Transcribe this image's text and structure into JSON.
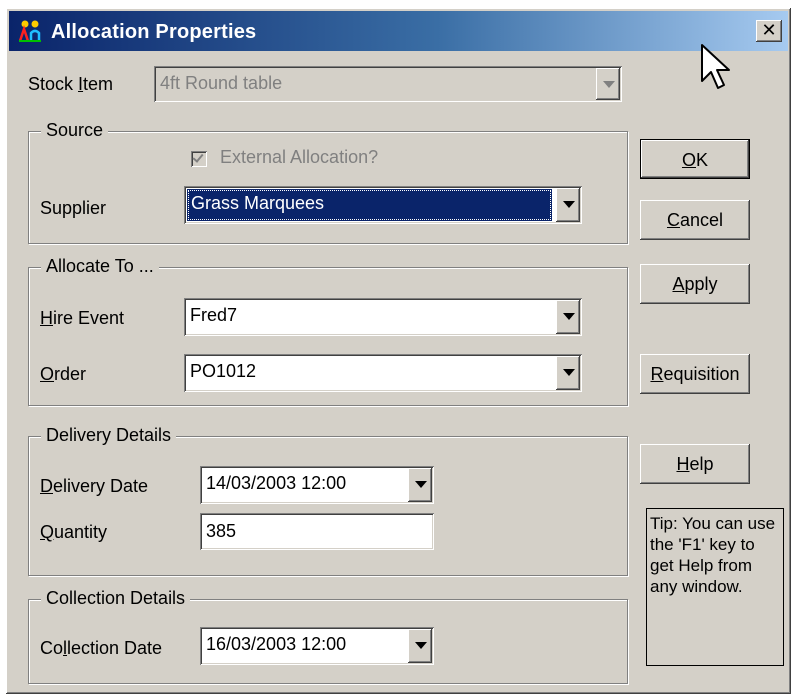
{
  "window": {
    "title": "Allocation Properties",
    "close_label": "✕"
  },
  "stock_item": {
    "label_pre": "Stock ",
    "label_accel": "I",
    "label_post": "tem",
    "value": "4ft Round table"
  },
  "source": {
    "legend": "Source",
    "external_label": "External Allocation?",
    "external_checked": true,
    "supplier_label": "Supplier",
    "supplier_value": "Grass Marquees"
  },
  "allocate_to": {
    "legend": "Allocate To ...",
    "hire_event_accel": "H",
    "hire_event_rest": "ire Event",
    "hire_event_value": "Fred7",
    "order_accel": "O",
    "order_rest": "rder",
    "order_value": "PO1012"
  },
  "delivery": {
    "legend": "Delivery Details",
    "date_accel": "D",
    "date_rest": "elivery Date",
    "date_value": "14/03/2003 12:00",
    "quantity_accel": "Q",
    "quantity_rest": "uantity",
    "quantity_value": "385"
  },
  "collection": {
    "legend": "Collection Details",
    "date_pre": "Co",
    "date_accel": "l",
    "date_post": "lection Date",
    "date_value": "16/03/2003 12:00"
  },
  "buttons": {
    "ok_accel": "O",
    "ok_rest": "K",
    "cancel_accel": "C",
    "cancel_rest": "ancel",
    "apply_accel": "A",
    "apply_rest": "pply",
    "requisition_accel": "R",
    "requisition_rest": "equisition",
    "help_accel": "H",
    "help_rest": "elp"
  },
  "tip": {
    "text": "Tip: You can use the 'F1' key to get Help from any window."
  },
  "icons": {
    "app": "allocation-app-icon",
    "close": "close-icon",
    "cursor": "mouse-pointer-icon"
  }
}
